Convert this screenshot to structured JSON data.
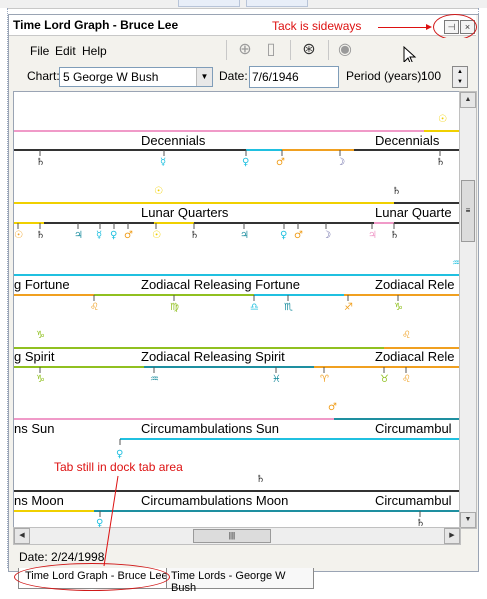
{
  "window": {
    "title": "Time Lord Graph - Bruce Lee"
  },
  "annotations": {
    "tack": "Tack is sideways",
    "dock_tab": "Tab still in dock tab area"
  },
  "menu": {
    "file": "File",
    "edit": "Edit",
    "help": "Help"
  },
  "toolbar": {
    "icons": [
      "chart-wheel-icon",
      "document-icon",
      "globe-chart-icon",
      "disk-icon"
    ]
  },
  "options": {
    "chart_label": "Chart:",
    "chart_value": "5 George W Bush",
    "date_label": "Date:",
    "date_value": "7/6/1946",
    "period_label": "Period (years):",
    "period_value": "100"
  },
  "graph_rows": [
    {
      "label": "Decennials",
      "label2": "Decennials"
    },
    {
      "label": "Lunar Quarters",
      "label2": "Lunar Quarte"
    },
    {
      "label_left": "g Fortune",
      "label": "Zodiacal Releasing Fortune",
      "label2": "Zodiacal Rele"
    },
    {
      "label_left": "g Spirit",
      "label": "Zodiacal Releasing Spirit",
      "label2": "Zodiacal Rele"
    },
    {
      "label_left": "ns Sun",
      "label": "Circumambulations Sun",
      "label2": "Circumambul"
    },
    {
      "label_left": "ns Moon",
      "label": "Circumambulations Moon",
      "label2": "Circumambul"
    }
  ],
  "colors": {
    "pink": "#f09ac8",
    "teal": "#1e8fa0",
    "orange": "#f0a020",
    "yellow": "#f0d000",
    "dark": "#333333",
    "cyan": "#20c0e0",
    "green": "#90c020",
    "purple": "#6060a0",
    "annotation": "#dd1111"
  },
  "status": {
    "text": "Date: 2/24/1998"
  },
  "tabs": [
    {
      "label": "Time Lord Graph - Bruce Lee"
    },
    {
      "label": "Time Lords - George W Bush"
    }
  ]
}
